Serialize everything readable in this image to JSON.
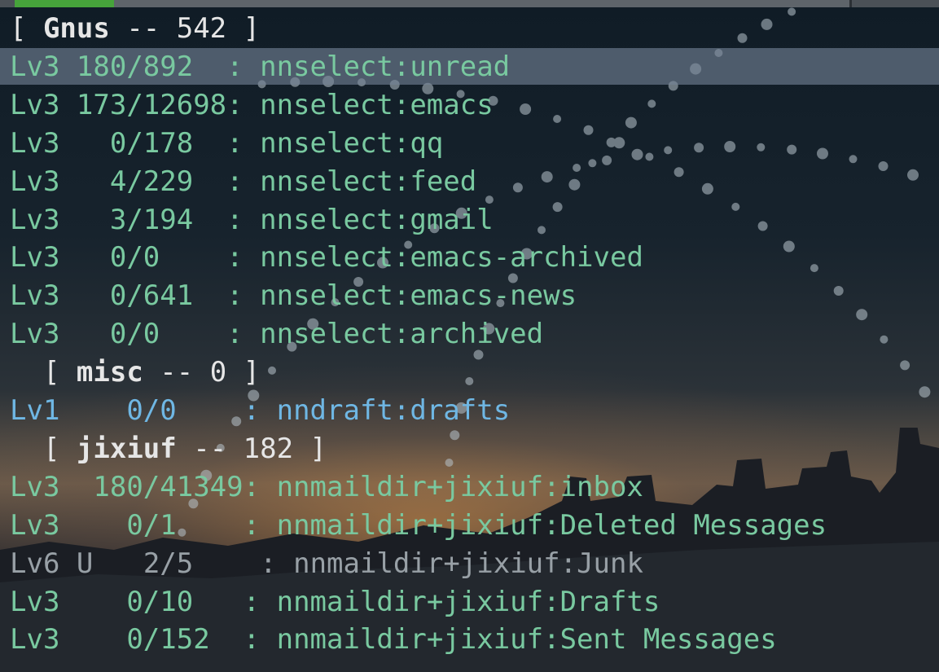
{
  "colors": {
    "group_green": "#79c9a0",
    "group_blue": "#6fb7e4",
    "group_gray": "#98a0a6",
    "header_white": "#e6e6e6",
    "selection": "#6e7f93",
    "active_tab": "#46a33b"
  },
  "sections": [
    {
      "header": {
        "open": "[ ",
        "name": "Gnus",
        "sep": " -- ",
        "count": "542",
        "close": " ]"
      },
      "groups": [
        {
          "level": "Lv3",
          "mark": "",
          "counts": "180/892",
          "name": "nnselect:unread",
          "selected": true
        },
        {
          "level": "Lv3",
          "mark": "",
          "counts": "173/12698",
          "name": "nnselect:emacs"
        },
        {
          "level": "Lv3",
          "mark": "",
          "counts": "0/178",
          "name": "nnselect:qq"
        },
        {
          "level": "Lv3",
          "mark": "",
          "counts": "4/229",
          "name": "nnselect:feed"
        },
        {
          "level": "Lv3",
          "mark": "",
          "counts": "3/194",
          "name": "nnselect:gmail"
        },
        {
          "level": "Lv3",
          "mark": "",
          "counts": "0/0",
          "name": "nnselect:emacs-archived"
        },
        {
          "level": "Lv3",
          "mark": "",
          "counts": "0/641",
          "name": "nnselect:emacs-news"
        },
        {
          "level": "Lv3",
          "mark": "",
          "counts": "0/0",
          "name": "nnselect:archived"
        }
      ]
    },
    {
      "header": {
        "open": "[ ",
        "name": "misc",
        "sep": " -- ",
        "count": "0",
        "close": " ]"
      },
      "groups": [
        {
          "level": "Lv1",
          "mark": "",
          "counts": "0/0",
          "name": "nndraft:drafts"
        }
      ]
    },
    {
      "header": {
        "open": "[ ",
        "name": "jixiuf",
        "sep": " -- ",
        "count": "182",
        "close": " ]"
      },
      "groups": [
        {
          "level": "Lv3",
          "mark": "",
          "counts": "180/41349",
          "name": "nnmaildir+jixiuf:inbox"
        },
        {
          "level": "Lv3",
          "mark": "",
          "counts": "0/1",
          "name": "nnmaildir+jixiuf:Deleted Messages"
        },
        {
          "level": "Lv6",
          "mark": "U",
          "counts": "2/5",
          "name": "nnmaildir+jixiuf:Junk"
        },
        {
          "level": "Lv3",
          "mark": "",
          "counts": "0/10",
          "name": "nnmaildir+jixiuf:Drafts"
        },
        {
          "level": "Lv3",
          "mark": "",
          "counts": "0/152",
          "name": "nnmaildir+jixiuf:Sent Messages"
        }
      ]
    }
  ]
}
